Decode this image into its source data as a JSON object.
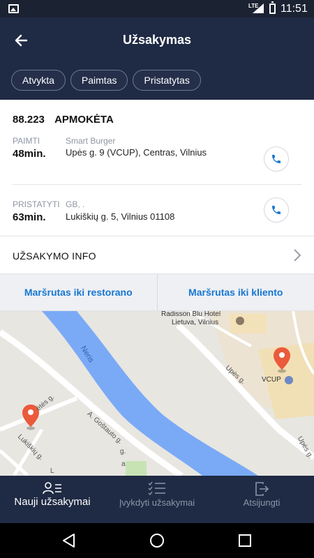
{
  "status_bar": {
    "network": "LTE",
    "time": "11:51",
    "icons": [
      "image-icon",
      "signal-icon",
      "battery-icon"
    ]
  },
  "header": {
    "title": "Užsakymas",
    "back_icon": "back-arrow-icon",
    "filters": [
      "Atvykta",
      "Paimtas",
      "Pristatytas"
    ]
  },
  "order": {
    "id": "88.223",
    "payment_status": "APMOKĖTA",
    "pickup": {
      "label": "PAIMTI",
      "time": "48min.",
      "name": "Smart Burger",
      "address": "Upės g. 9 (VCUP), Centras, Vilnius",
      "call_icon": "phone-icon"
    },
    "delivery": {
      "label": "PRISTATYTI",
      "time": "63min.",
      "name": "GB, .",
      "address": "Lukiškių g. 5, Vilnius 01108",
      "call_icon": "phone-icon"
    }
  },
  "info_row": {
    "label": "UŽSAKYMO INFO",
    "icon": "chevron-right-icon"
  },
  "routes": {
    "to_restaurant": "Maršrutas iki restorano",
    "to_client": "Maršrutas iki kliento"
  },
  "map": {
    "labels": {
      "hotel_line1": "Radisson Blu Hotel",
      "hotel_line2": "Lietuva, Vilnius",
      "vcup": "VCUP",
      "river": "Neris",
      "upes": "Upės g.",
      "gostauto": "A. Goštauto g.",
      "lukiskiu": "Lukiškių g.",
      "upes2": "Upės g.",
      "street_a": "a",
      "street_l": "L",
      "street_g": "g.",
      "street_etes": "ėtės g."
    },
    "colors": {
      "water": "#7aaaf6",
      "pin": "#ea5a3b",
      "park": "#c8e3b3"
    }
  },
  "bottom_nav": [
    {
      "label": "Nauji užsakymai",
      "icon": "new-orders-icon",
      "active": true
    },
    {
      "label": "Įvykdyti užsakymai",
      "icon": "completed-orders-icon",
      "active": false
    },
    {
      "label": "Atsijungti",
      "icon": "logout-icon",
      "active": false
    }
  ],
  "colors": {
    "header_bg": "#1f2a44",
    "accent": "#1677d2"
  }
}
